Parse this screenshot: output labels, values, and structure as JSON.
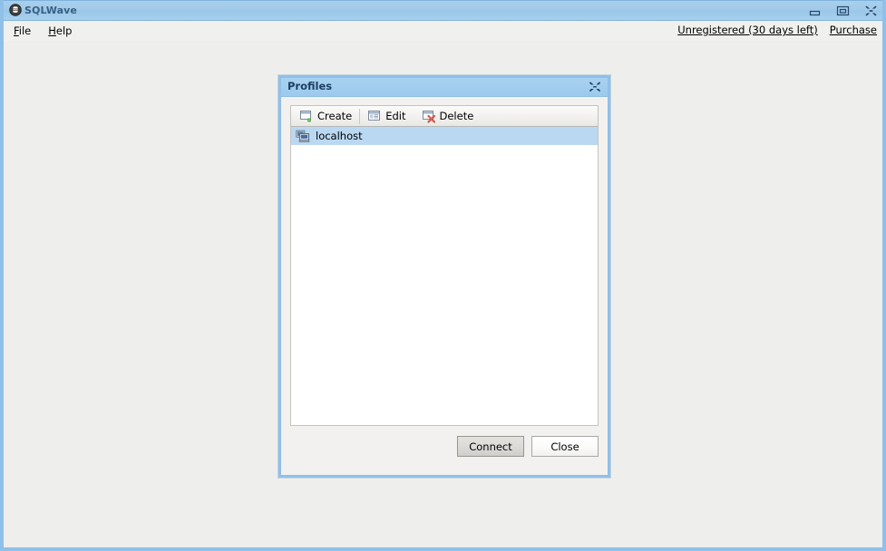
{
  "window": {
    "title": "SQLWave",
    "app_icon": "database-icon",
    "controls": [
      {
        "name": "minimize",
        "glyph": "minimize-icon"
      },
      {
        "name": "maximize",
        "glyph": "maximize-icon"
      },
      {
        "name": "close",
        "glyph": "close-icon"
      }
    ]
  },
  "menubar": {
    "items": [
      {
        "label": "File",
        "mnemonic": "F",
        "rest": "ile"
      },
      {
        "label": "Help",
        "mnemonic": "H",
        "rest": "elp"
      }
    ],
    "registration": {
      "status": "Unregistered (30 days left)",
      "purchase": "Purchase"
    }
  },
  "dialog": {
    "title": "Profiles",
    "close_glyph": "close-icon",
    "toolbar": {
      "create": "Create",
      "edit": "Edit",
      "delete": "Delete"
    },
    "profiles": [
      {
        "name": "localhost",
        "icon": "server-computer-icon",
        "selected": true
      }
    ],
    "footer": {
      "connect": "Connect",
      "close": "Close"
    }
  },
  "colors": {
    "titlebar_blue": "#a2cbea",
    "window_border": "#8fc0e9",
    "desktop": "#eeeeec",
    "dialog_bg": "#f2f1ef",
    "selection": "#bad8f2",
    "title_text": "#3a5f86",
    "dialog_title_text": "#1c3f63",
    "accent_green": "#6db33f",
    "accent_red": "#d2453d"
  }
}
